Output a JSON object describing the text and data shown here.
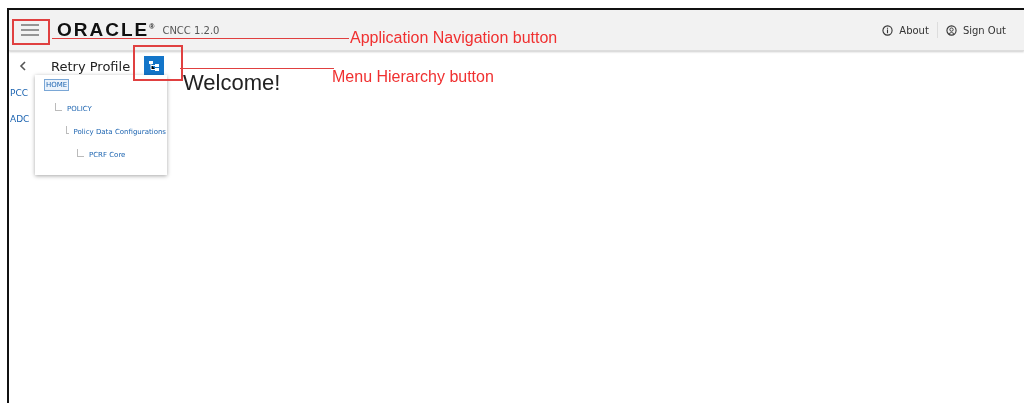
{
  "header": {
    "logo": "ORACLE",
    "logo_mark": "®",
    "product": "CNCC 1.2.0",
    "actions": [
      {
        "kind": "info",
        "label": "About"
      },
      {
        "kind": "user",
        "label": "Sign Out"
      }
    ]
  },
  "subheader": {
    "title": "Retry Profile"
  },
  "sidebar": {
    "items": [
      {
        "label": "PCC"
      },
      {
        "label": "ADC"
      }
    ]
  },
  "hierarchy": [
    {
      "label": "HOME",
      "selected": true,
      "children": [
        {
          "label": "POLICY",
          "selected": false,
          "children": [
            {
              "label": "Policy Data Configurations",
              "selected": false,
              "children": [
                {
                  "label": "PCRF Core",
                  "selected": false
                }
              ]
            }
          ]
        }
      ]
    }
  ],
  "main": {
    "heading": "Welcome!"
  },
  "annotations": [
    {
      "label": "Application Navigation button"
    },
    {
      "label": "Menu Hierarchy button"
    }
  ]
}
